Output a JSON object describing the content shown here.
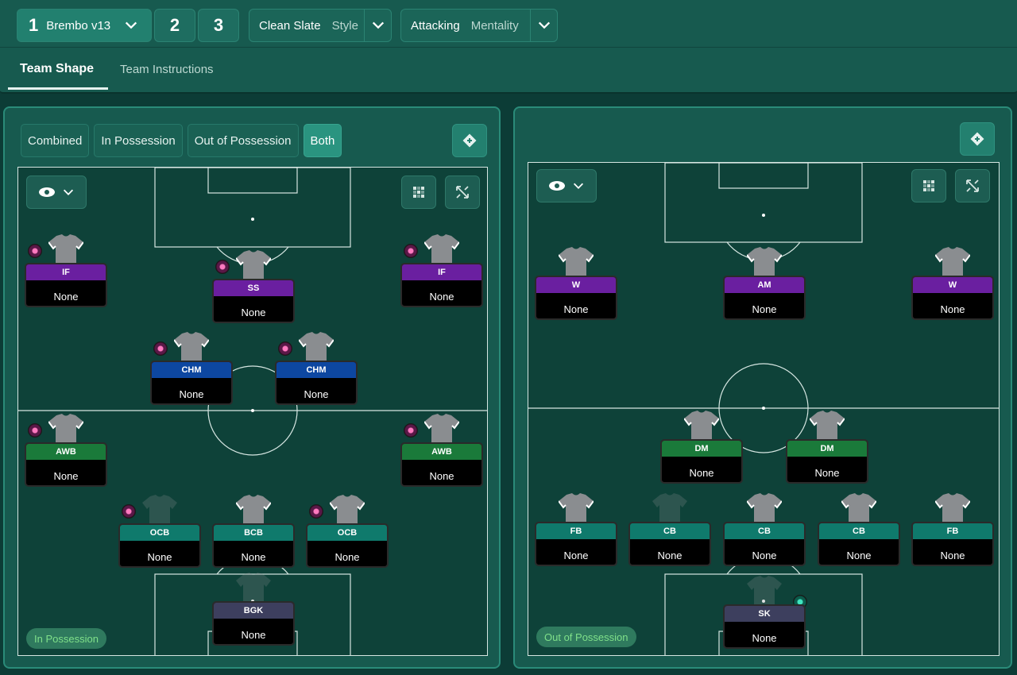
{
  "topbar": {
    "tactics": [
      {
        "num": "1",
        "name": "Brembo v13",
        "active": true
      },
      {
        "num": "2",
        "name": ""
      },
      {
        "num": "3",
        "name": ""
      }
    ],
    "style": {
      "label": "Clean Slate",
      "sub": "Style"
    },
    "mentality": {
      "label": "Attacking",
      "sub": "Mentality"
    },
    "tabs": [
      "Team Shape",
      "Team Instructions"
    ]
  },
  "left_panel": {
    "filters": [
      "Combined",
      "In Possession",
      "Out of Possession",
      "Both"
    ],
    "active_filter": "Both",
    "phase": "In Possession",
    "players": [
      {
        "role": "IF",
        "duty": "None",
        "color": "#6a1fa0"
      },
      {
        "role": "SS",
        "duty": "None",
        "color": "#6a1fa0"
      },
      {
        "role": "IF",
        "duty": "None",
        "color": "#6a1fa0"
      },
      {
        "role": "CHM",
        "duty": "None",
        "color": "#0d47a1"
      },
      {
        "role": "CHM",
        "duty": "None",
        "color": "#0d47a1"
      },
      {
        "role": "AWB",
        "duty": "None",
        "color": "#1a7a3a"
      },
      {
        "role": "AWB",
        "duty": "None",
        "color": "#1a7a3a"
      },
      {
        "role": "OCB",
        "duty": "None",
        "color": "#0f7a6c"
      },
      {
        "role": "BCB",
        "duty": "None",
        "color": "#0f7a6c"
      },
      {
        "role": "OCB",
        "duty": "None",
        "color": "#0f7a6c"
      },
      {
        "role": "BGK",
        "duty": "None",
        "color": "#3d3f5e"
      }
    ]
  },
  "right_panel": {
    "phase": "Out of Possession",
    "players": [
      {
        "role": "W",
        "duty": "None",
        "color": "#6a1fa0"
      },
      {
        "role": "AM",
        "duty": "None",
        "color": "#6a1fa0"
      },
      {
        "role": "W",
        "duty": "None",
        "color": "#6a1fa0"
      },
      {
        "role": "DM",
        "duty": "None",
        "color": "#1a7a3a"
      },
      {
        "role": "DM",
        "duty": "None",
        "color": "#1a7a3a"
      },
      {
        "role": "FB",
        "duty": "None",
        "color": "#0f7a6c"
      },
      {
        "role": "CB",
        "duty": "None",
        "color": "#0f7a6c"
      },
      {
        "role": "CB",
        "duty": "None",
        "color": "#0f7a6c"
      },
      {
        "role": "CB",
        "duty": "None",
        "color": "#0f7a6c"
      },
      {
        "role": "FB",
        "duty": "None",
        "color": "#0f7a6c"
      },
      {
        "role": "SK",
        "duty": "None",
        "color": "#3d3f5e"
      }
    ]
  }
}
